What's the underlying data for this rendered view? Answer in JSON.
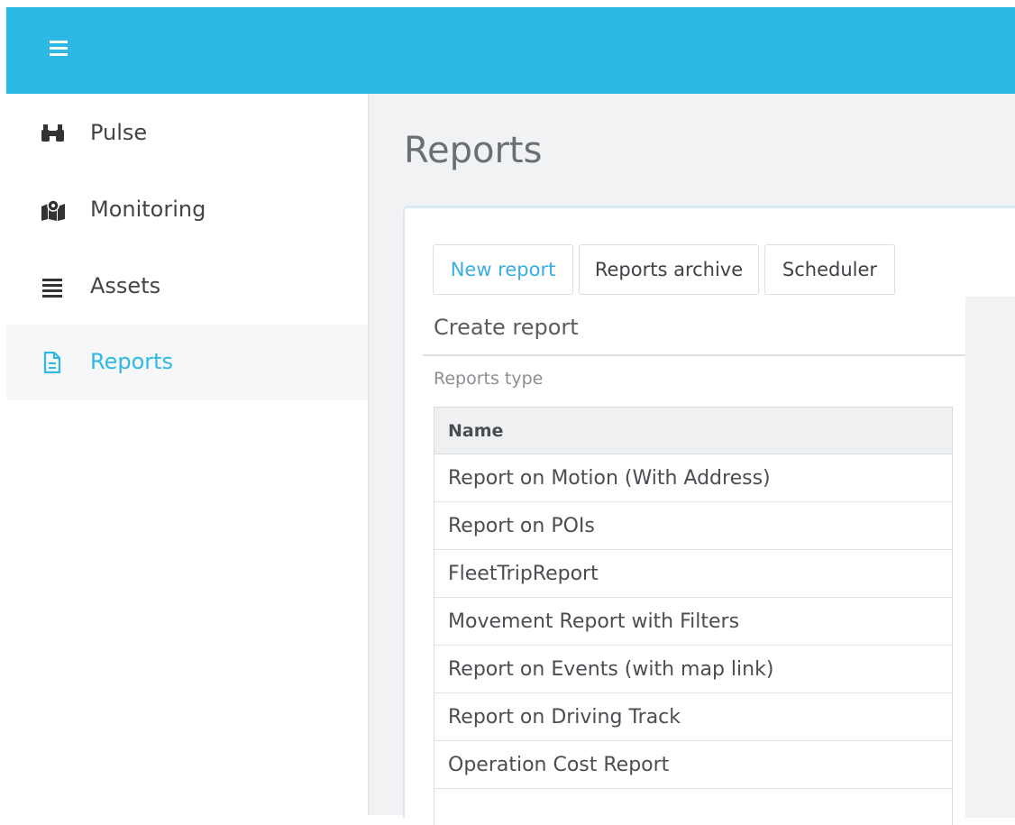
{
  "colors": {
    "accent": "#2db9e6",
    "sidebar_active_bg": "#f6f7f8",
    "main_bg": "#f1f2f4",
    "text": "#444444"
  },
  "topbar": {
    "menu_icon": "hamburger-menu-icon"
  },
  "sidebar": {
    "items": [
      {
        "label": "Pulse",
        "icon": "binoculars-icon",
        "active": false
      },
      {
        "label": "Monitoring",
        "icon": "map-pin-icon",
        "active": false
      },
      {
        "label": "Assets",
        "icon": "list-icon",
        "active": false
      },
      {
        "label": "Reports",
        "icon": "document-icon",
        "active": true
      }
    ]
  },
  "main": {
    "title": "Reports",
    "tabs": [
      {
        "label": "New report",
        "active": true
      },
      {
        "label": "Reports archive",
        "active": false
      },
      {
        "label": "Scheduler",
        "active": false
      }
    ],
    "section_title": "Create report",
    "section_subtitle": "Reports type",
    "table": {
      "header": "Name",
      "rows": [
        "Report on Motion (With Address)",
        "Report on POIs",
        "FleetTripReport",
        "Movement Report with Filters",
        "Report on Events (with map link)",
        "Report on Driving Track",
        "Operation Cost Report"
      ]
    }
  }
}
